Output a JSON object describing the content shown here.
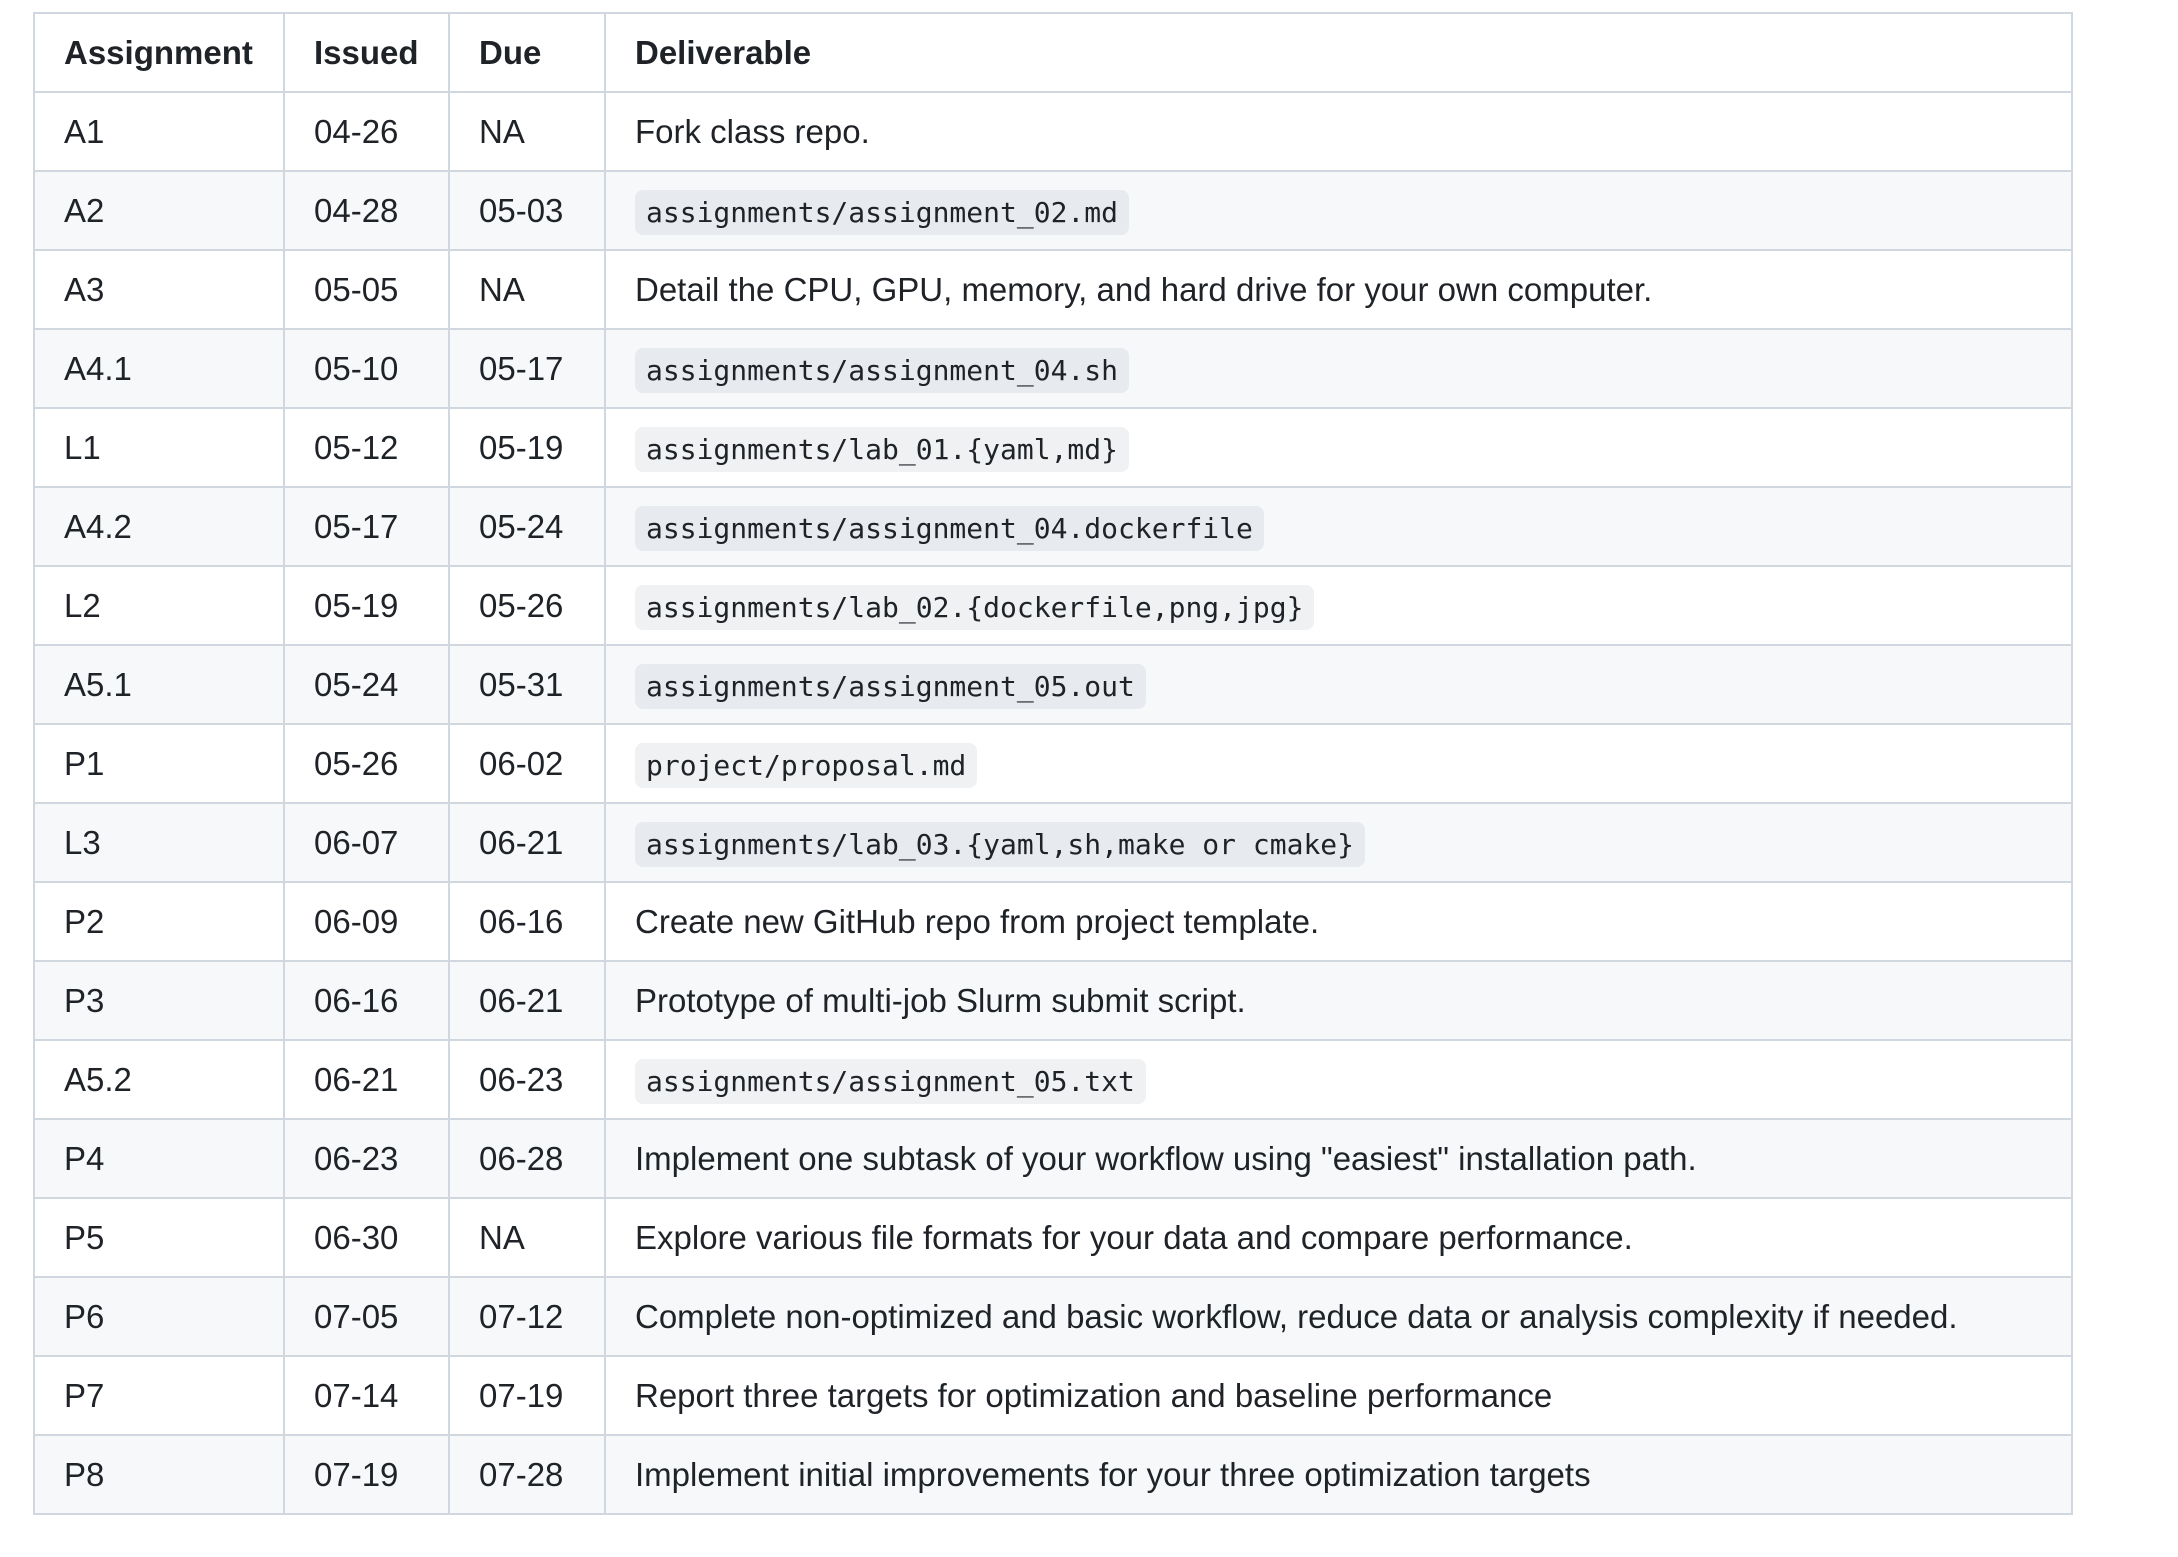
{
  "table": {
    "headers": [
      "Assignment",
      "Issued",
      "Due",
      "Deliverable"
    ],
    "rows": [
      {
        "assignment": "A1",
        "issued": "04-26",
        "due": "NA",
        "deliverable": "Fork class repo.",
        "code": false
      },
      {
        "assignment": "A2",
        "issued": "04-28",
        "due": "05-03",
        "deliverable": "assignments/assignment_02.md",
        "code": true
      },
      {
        "assignment": "A3",
        "issued": "05-05",
        "due": "NA",
        "deliverable": "Detail the CPU, GPU, memory, and hard drive for your own computer.",
        "code": false
      },
      {
        "assignment": "A4.1",
        "issued": "05-10",
        "due": "05-17",
        "deliverable": "assignments/assignment_04.sh",
        "code": true
      },
      {
        "assignment": "L1",
        "issued": "05-12",
        "due": "05-19",
        "deliverable": "assignments/lab_01.{yaml,md}",
        "code": true
      },
      {
        "assignment": "A4.2",
        "issued": "05-17",
        "due": "05-24",
        "deliverable": "assignments/assignment_04.dockerfile",
        "code": true
      },
      {
        "assignment": "L2",
        "issued": "05-19",
        "due": "05-26",
        "deliverable": "assignments/lab_02.{dockerfile,png,jpg}",
        "code": true
      },
      {
        "assignment": "A5.1",
        "issued": "05-24",
        "due": "05-31",
        "deliverable": "assignments/assignment_05.out",
        "code": true
      },
      {
        "assignment": "P1",
        "issued": "05-26",
        "due": "06-02",
        "deliverable": "project/proposal.md",
        "code": true
      },
      {
        "assignment": "L3",
        "issued": "06-07",
        "due": "06-21",
        "deliverable": "assignments/lab_03.{yaml,sh,make or cmake}",
        "code": true
      },
      {
        "assignment": "P2",
        "issued": "06-09",
        "due": "06-16",
        "deliverable": "Create new GitHub repo from project template.",
        "code": false
      },
      {
        "assignment": "P3",
        "issued": "06-16",
        "due": "06-21",
        "deliverable": "Prototype of multi-job Slurm submit script.",
        "code": false
      },
      {
        "assignment": "A5.2",
        "issued": "06-21",
        "due": "06-23",
        "deliverable": "assignments/assignment_05.txt",
        "code": true
      },
      {
        "assignment": "P4",
        "issued": "06-23",
        "due": "06-28",
        "deliverable": "Implement one subtask of your workflow using \"easiest\" installation path.",
        "code": false
      },
      {
        "assignment": "P5",
        "issued": "06-30",
        "due": "NA",
        "deliverable": "Explore various file formats for your data and compare performance.",
        "code": false
      },
      {
        "assignment": "P6",
        "issued": "07-05",
        "due": "07-12",
        "deliverable": "Complete non-optimized and basic workflow, reduce data or analysis complexity if needed.",
        "code": false
      },
      {
        "assignment": "P7",
        "issued": "07-14",
        "due": "07-19",
        "deliverable": "Report three targets for optimization and baseline performance",
        "code": false
      },
      {
        "assignment": "P8",
        "issued": "07-19",
        "due": "07-28",
        "deliverable": "Implement initial improvements for your three optimization targets",
        "code": false
      }
    ]
  }
}
